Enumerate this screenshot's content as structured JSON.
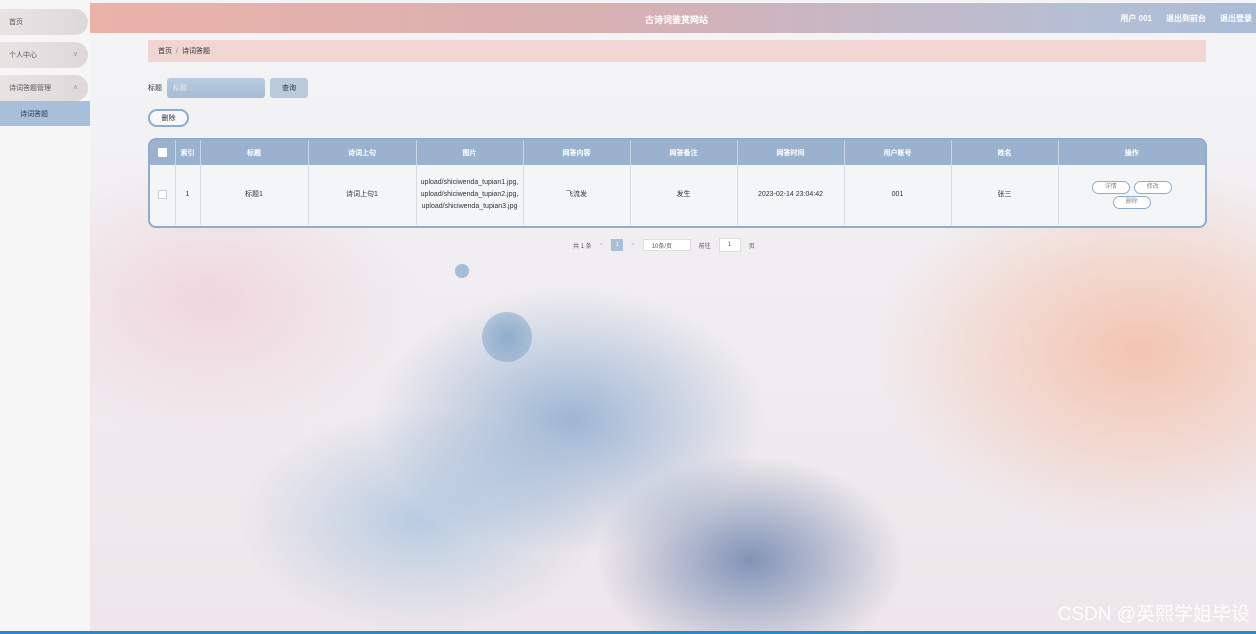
{
  "header": {
    "site_title": "古诗词鉴赏网站",
    "user": "用户 001",
    "back_to_admin": "退出到前台",
    "logout": "退出登录"
  },
  "sidebar": {
    "items": [
      {
        "label": "首页",
        "chevron": ""
      },
      {
        "label": "个人中心",
        "chevron": "∨"
      },
      {
        "label": "诗词答题管理",
        "chevron": "∧"
      }
    ],
    "sub_active": "诗词答题"
  },
  "breadcrumb": {
    "home": "首页",
    "separator": "/",
    "current": "诗词答题"
  },
  "search": {
    "label": "标题",
    "placeholder": "标题",
    "button": "查询"
  },
  "toolbar": {
    "delete": "删除"
  },
  "table": {
    "headers": [
      "",
      "索引",
      "标题",
      "诗词上句",
      "图片",
      "网答内容",
      "网答备注",
      "网答时间",
      "用户账号",
      "姓名",
      "操作"
    ],
    "rows": [
      {
        "index": "1",
        "title": "标题1",
        "verse": "诗词上句1",
        "images": "upload/shiciwenda_tupian1.jpg,upload/shiciwenda_tupian2.jpg,upload/shiciwenda_tupian3.jpg",
        "answer": "飞流发",
        "remark": "发生",
        "time": "2023-02-14 23:04:42",
        "account": "001",
        "name": "张三",
        "actions": {
          "detail": "详情",
          "edit": "修改",
          "delete": "删除"
        }
      }
    ]
  },
  "pager": {
    "total": "共 1 条",
    "prev": "<",
    "current": "1",
    "next": ">",
    "page_size": "10条/页",
    "goto": "前往",
    "goto_value": "1",
    "page_unit": "页"
  },
  "watermark": "CSDN @英熙学姐毕设"
}
